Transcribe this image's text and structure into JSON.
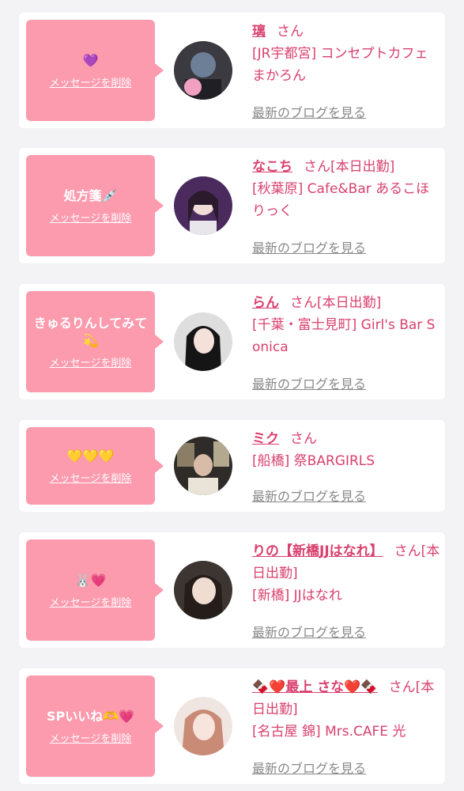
{
  "delete_label": "メッセージを削除",
  "blog_label": "最新のブログを見る",
  "items": [
    {
      "message": "💜",
      "name": "璃",
      "san": "さん",
      "badge": "",
      "shop": "[JR宇都宮] コンセプトカフェ まかろん"
    },
    {
      "message": "処方箋💉",
      "name": "なこち",
      "san": "さん",
      "badge": "[本日出勤]",
      "shop": "[秋葉原] Cafe&Bar あるこほりっく"
    },
    {
      "message": "きゅるりんしてみて💫",
      "name": "らん",
      "san": "さん",
      "badge": "[本日出勤]",
      "shop": "[千葉・富士見町] Girl's Bar Sonica"
    },
    {
      "message": "💛💛💛",
      "name": "ミク",
      "san": "さん",
      "badge": "",
      "shop": "[船橋] 祭BARGIRLS"
    },
    {
      "message": "🐰💗",
      "name": "りの【新橋JJはなれ】",
      "san": "さん",
      "badge": "[本日出勤]",
      "shop": "[新橋] JJはなれ"
    },
    {
      "message": "SPいいね🫶💗",
      "name": "🍫❤️最上 さな❤️🍫",
      "san": "さん",
      "badge": "[本日出勤]",
      "shop": "[名古屋 錦] Mrs.CAFE 光"
    }
  ],
  "colors": {
    "accent": "#d9406e",
    "bubble": "#fc9aae",
    "background": "#f3f2f4"
  }
}
